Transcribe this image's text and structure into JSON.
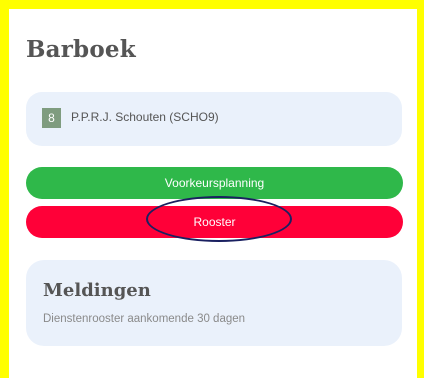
{
  "header": {
    "title": "Barboek"
  },
  "user": {
    "badge": "8",
    "name": "P.P.R.J. Schouten (SCHO9)"
  },
  "buttons": {
    "preferences_label": "Voorkeursplanning",
    "schedule_label": "Rooster"
  },
  "notifications": {
    "title": "Meldingen",
    "subtitle": "Dienstenrooster aankomende 30 dagen"
  },
  "colors": {
    "frame": "#ffff00",
    "preferences_button": "#2fb84a",
    "schedule_button": "#ff0038",
    "card_background": "#eaf1fb",
    "badge_background": "#7f9c7f",
    "highlight_outline": "#1a2060"
  }
}
